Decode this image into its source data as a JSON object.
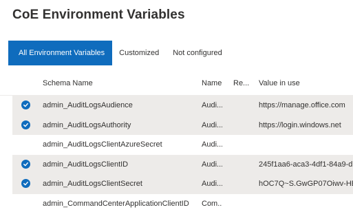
{
  "page": {
    "title": "CoE Environment Variables"
  },
  "tabs": [
    {
      "label": "All Environment Variables",
      "active": true
    },
    {
      "label": "Customized",
      "active": false
    },
    {
      "label": "Not configured",
      "active": false
    }
  ],
  "grid": {
    "columns": {
      "schema_name": "Schema Name",
      "name": "Name",
      "required": "Re...",
      "value_in_use": "Value in use"
    },
    "rows": [
      {
        "schema_name": "admin_AuditLogsAudience",
        "name": "Audi...",
        "value_in_use": "https://manage.office.com",
        "selected": true
      },
      {
        "schema_name": "admin_AuditLogsAuthority",
        "name": "Audi...",
        "value_in_use": "https://login.windows.net",
        "selected": true
      },
      {
        "schema_name": "admin_AuditLogsClientAzureSecret",
        "name": "Audi...",
        "value_in_use": "",
        "selected": false
      },
      {
        "schema_name": "admin_AuditLogsClientID",
        "name": "Audi...",
        "value_in_use": "245f1aa6-aca3-4df1-84a9-d",
        "selected": true
      },
      {
        "schema_name": "admin_AuditLogsClientSecret",
        "name": "Audi...",
        "value_in_use": "hOC7Q~S.GwGP07Oiwv-HE",
        "selected": true
      },
      {
        "schema_name": "admin_CommandCenterApplicationClientID",
        "name": "Com...",
        "value_in_use": "",
        "selected": false
      }
    ]
  }
}
